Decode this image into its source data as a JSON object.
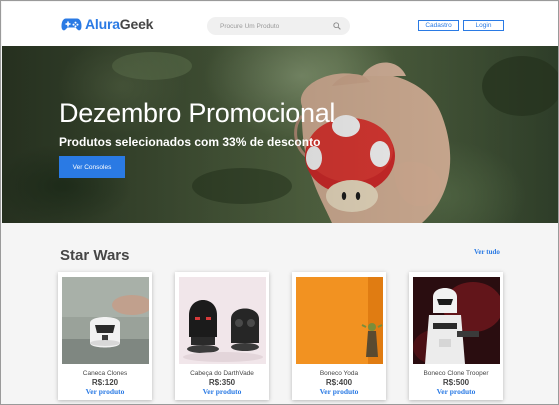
{
  "colors": {
    "accent": "#2a7ae4",
    "text": "#464646",
    "background": "#f5f5f5"
  },
  "header": {
    "logo": {
      "part1": "Alura",
      "part2": "Geek",
      "icon": "gamepad-icon"
    },
    "search": {
      "placeholder": "Procure Um Produto",
      "icon": "search-icon"
    },
    "signup_label": "Cadastro",
    "login_label": "Login"
  },
  "hero": {
    "title": "Dezembro Promocional",
    "subtitle": "Produtos selecionados com 33% de desconto",
    "button_label": "Ver Consoles"
  },
  "section": {
    "title": "Star Wars",
    "see_all_label": "Ver tudo",
    "products": [
      {
        "name": "Caneca Clones",
        "price": "R$:120",
        "link": "Ver produto"
      },
      {
        "name": "Cabeça do DarthVade",
        "price": "R$:350",
        "link": "Ver produto"
      },
      {
        "name": "Boneco Yoda",
        "price": "R$:400",
        "link": "Ver produto"
      },
      {
        "name": "Boneco Clone Trooper",
        "price": "R$:500",
        "link": "Ver produto"
      }
    ]
  }
}
